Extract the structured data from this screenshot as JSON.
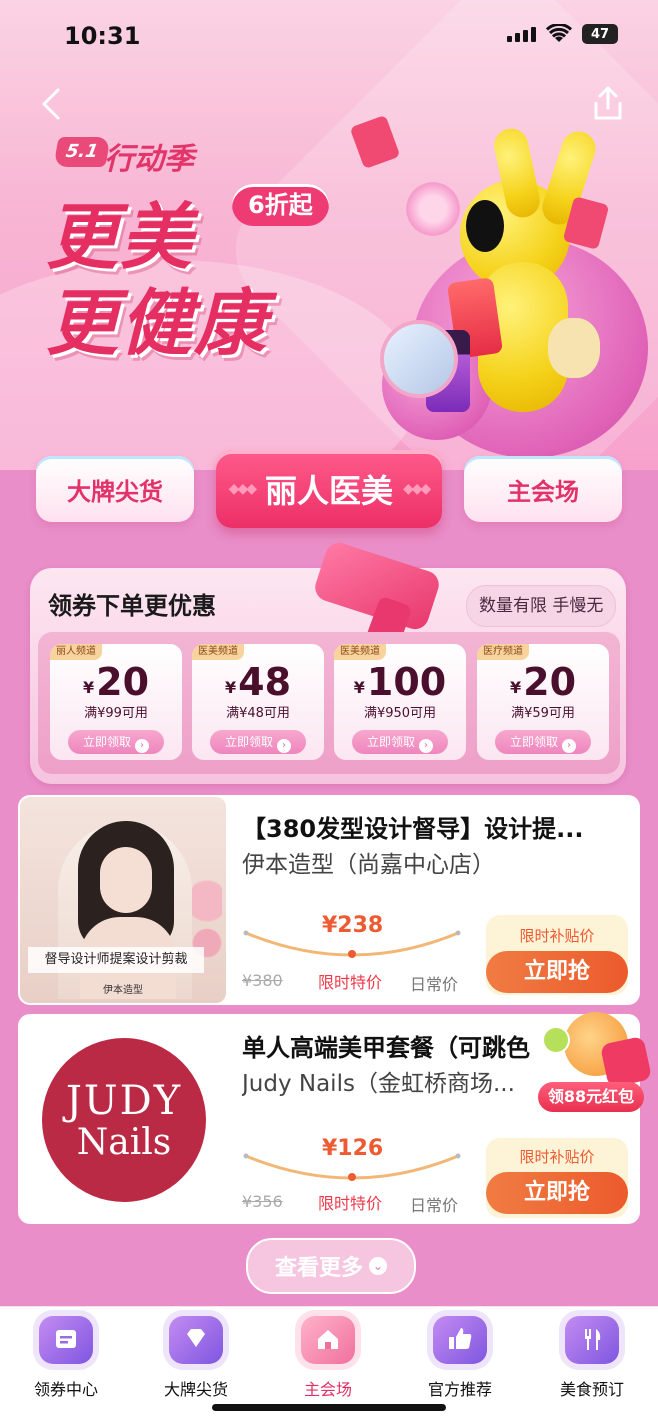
{
  "status_bar": {
    "time": "10:31",
    "battery": "47"
  },
  "hero": {
    "badge": "5.1",
    "season": "行动季",
    "headline_line1": "更美",
    "headline_line2": "更健康",
    "discount": "6折起"
  },
  "tabs": [
    {
      "label": "大牌尖货"
    },
    {
      "label": "丽人医美",
      "active": true
    },
    {
      "label": "主会场"
    }
  ],
  "coupons": {
    "title": "领券下单更优惠",
    "limit_text": "数量有限 手慢无",
    "currency": "¥",
    "claim_label": "立即领取",
    "items": [
      {
        "tag": "丽人频道",
        "amount": "20",
        "condition": "满¥99可用"
      },
      {
        "tag": "医美频道",
        "amount": "48",
        "condition": "满¥48可用"
      },
      {
        "tag": "医美频道",
        "amount": "100",
        "condition": "满¥950可用"
      },
      {
        "tag": "医疗频道",
        "amount": "20",
        "condition": "满¥59可用"
      }
    ]
  },
  "products": [
    {
      "title": "【380发型设计督导】设计提...",
      "store": "伊本造型（尚嘉中心店）",
      "image_caption": "督导设计师提案设计剪裁",
      "image_footer": "伊本造型",
      "price": "¥238",
      "original_price": "¥380",
      "special_label": "限时特价",
      "daily_label": "日常价",
      "subsidy_label": "限时补贴价",
      "buy_label": "立即抢"
    },
    {
      "title": "单人高端美甲套餐（可跳色",
      "store": "Judy Nails（金虹桥商场...",
      "logo_line1": "JUDY",
      "logo_line2": "Nails",
      "price": "¥126",
      "original_price": "¥356",
      "special_label": "限时特价",
      "daily_label": "日常价",
      "subsidy_label": "限时补贴价",
      "buy_label": "立即抢"
    }
  ],
  "floating_promo": {
    "text": "领88元红包"
  },
  "more_button": {
    "label": "查看更多"
  },
  "bottom_nav": [
    {
      "label": "领券中心",
      "icon": "coupon-icon"
    },
    {
      "label": "大牌尖货",
      "icon": "diamond-icon"
    },
    {
      "label": "主会场",
      "icon": "home-icon",
      "active": true
    },
    {
      "label": "官方推荐",
      "icon": "thumbs-up-icon"
    },
    {
      "label": "美食预订",
      "icon": "fork-knife-icon"
    }
  ],
  "colors": {
    "accent": "#e52f62",
    "background": "#e98ec8",
    "price": "#ee5a32"
  }
}
